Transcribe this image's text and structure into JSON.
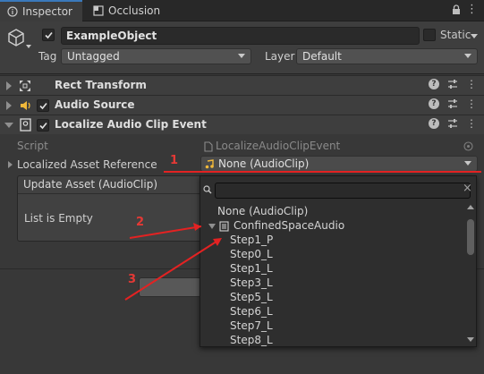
{
  "tabs": [
    {
      "label": "Inspector",
      "icon": "info-icon"
    },
    {
      "label": "Occlusion",
      "icon": "occlusion-icon"
    }
  ],
  "object": {
    "name": "ExampleObject",
    "static_label": "Static",
    "tag_label": "Tag",
    "tag_value": "Untagged",
    "layer_label": "Layer",
    "layer_value": "Default"
  },
  "components": [
    {
      "title": "Rect Transform",
      "icon": "rect-transform-icon"
    },
    {
      "title": "Audio Source",
      "icon": "audio-source-icon"
    },
    {
      "title": "Localize Audio Clip Event",
      "icon": "localize-icon"
    }
  ],
  "properties": {
    "script_label": "Script",
    "script_value": "LocalizeAudioClipEvent",
    "asset_ref_label": "Localized Asset Reference",
    "asset_ref_value": "None (AudioClip)"
  },
  "panel": {
    "header": "Update Asset (AudioClip)",
    "empty_text": "List is Empty"
  },
  "popup": {
    "search_placeholder": "",
    "items": [
      "None (AudioClip)",
      "ConfinedSpaceAudio",
      "Step1_P",
      "Step0_L",
      "Step1_L",
      "Step3_L",
      "Step5_L",
      "Step6_L",
      "Step7_L",
      "Step8_L"
    ]
  },
  "annotations": [
    "1",
    "2",
    "3"
  ],
  "colors": {
    "accent": "#3a79bb",
    "annotation_red": "#e32222"
  }
}
